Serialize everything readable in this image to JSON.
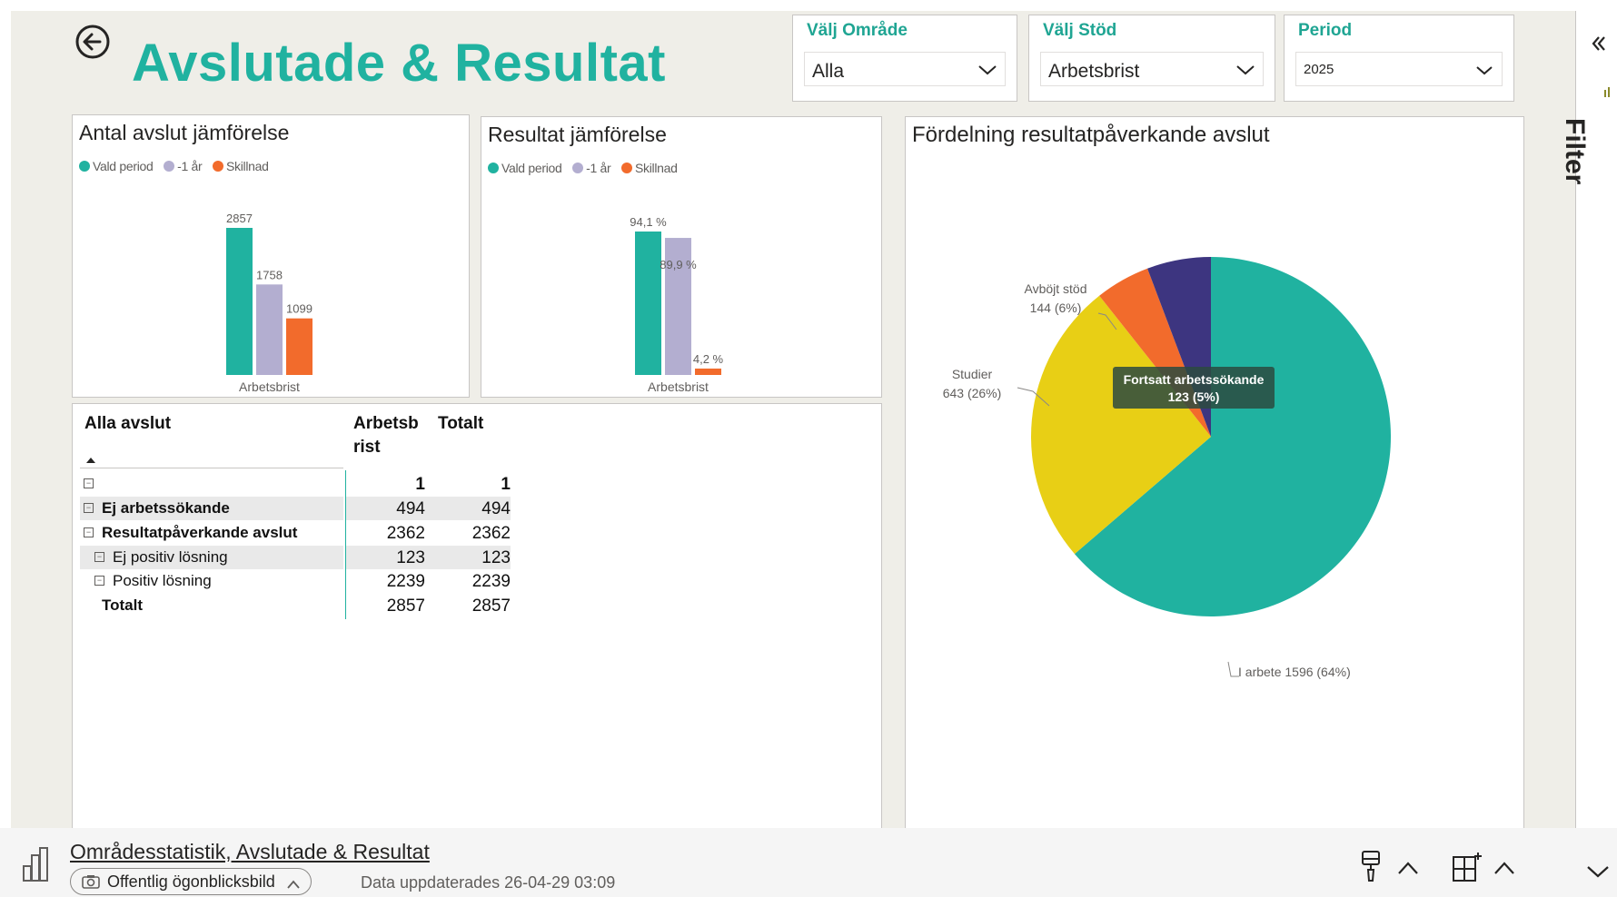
{
  "page": {
    "title": "Avslutade & Resultat",
    "back_icon": "arrow-left-circle-icon"
  },
  "slicers": [
    {
      "label": "Välj Område",
      "value": "Alla"
    },
    {
      "label": "Välj Stöd",
      "value": "Arbetsbrist"
    },
    {
      "label": "Period",
      "value": "2025"
    }
  ],
  "legend": [
    {
      "label": "Vald period",
      "color": "#20b2a0"
    },
    {
      "label": "-1 år",
      "color": "#b3aed0"
    },
    {
      "label": "Skillnad",
      "color": "#f26b2c"
    }
  ],
  "chart_data": [
    {
      "type": "bar",
      "title": "Antal avslut jämförelse",
      "categories": [
        "Arbetsbrist"
      ],
      "series": [
        {
          "name": "Vald period",
          "values": [
            2857
          ],
          "labels": [
            "2857"
          ]
        },
        {
          "name": "-1 år",
          "values": [
            1758
          ],
          "labels": [
            "1758"
          ]
        },
        {
          "name": "Skillnad",
          "values": [
            1099
          ],
          "labels": [
            "1099"
          ]
        }
      ],
      "ylim": [
        0,
        2857
      ]
    },
    {
      "type": "bar",
      "title": "Resultat jämförelse",
      "categories": [
        "Arbetsbrist"
      ],
      "series": [
        {
          "name": "Vald period",
          "values": [
            94.1
          ],
          "labels": [
            "94,1 %"
          ]
        },
        {
          "name": "-1 år",
          "values": [
            89.9
          ],
          "labels": [
            "89,9 %"
          ]
        },
        {
          "name": "Skillnad",
          "values": [
            4.2
          ],
          "labels": [
            "4,2 %"
          ]
        }
      ],
      "ylim": [
        0,
        94.1
      ]
    },
    {
      "type": "pie",
      "title": "Fördelning resultatpåverkande avslut",
      "slices": [
        {
          "name": "I arbete",
          "value": 1596,
          "label": "I arbete 1596 (64%)",
          "color": "#20b2a0"
        },
        {
          "name": "Studier",
          "value": 643,
          "label": "Studier\n643 (26%)",
          "color": "#e8cf15"
        },
        {
          "name": "Fortsatt arbetssökande",
          "value": 123,
          "label": "",
          "color": "#f26b2c"
        },
        {
          "name": "Avböjt stöd",
          "value": 144,
          "label": "Avböjt stöd\n144 (6%)",
          "color": "#3d3580"
        }
      ],
      "tooltip": {
        "name": "Fortsatt arbetssökande",
        "value": "123 (5%)"
      }
    }
  ],
  "matrix": {
    "headers": {
      "label": "Alla avslut",
      "col1": "Arbetsb rist",
      "col1_line1": "Arbetsb",
      "col1_line2": "rist",
      "col2": "Totalt"
    },
    "rows": [
      {
        "label": "",
        "col1": "1",
        "col2": "1"
      },
      {
        "label": "Ej arbetssökande",
        "col1": "494",
        "col2": "494"
      },
      {
        "label": "Resultatpåverkande avslut",
        "col1": "2362",
        "col2": "2362"
      },
      {
        "label": "Ej positiv lösning",
        "col1": "123",
        "col2": "123"
      },
      {
        "label": "Positiv lösning",
        "col1": "2239",
        "col2": "2239"
      },
      {
        "label": "Totalt",
        "col1": "2857",
        "col2": "2857"
      }
    ]
  },
  "filter_pane": {
    "label": "Filter",
    "collapse_icon": "double-chevron-left-icon"
  },
  "footer": {
    "title": "Områdesstatistik, Avslutade & Resultat",
    "snapshot": "Offentlig ögonblicksbild",
    "updated": "Data uppdaterades 26-04-29 03:09"
  }
}
